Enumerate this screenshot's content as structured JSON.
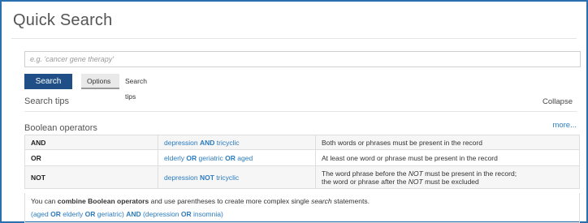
{
  "title": "Quick Search",
  "search": {
    "placeholder": "e.g. 'cancer gene therapy'",
    "value": ""
  },
  "buttons": {
    "search": "Search"
  },
  "tabs": [
    {
      "label": "Options"
    },
    {
      "label": "Search tips"
    }
  ],
  "tips": {
    "heading": "Search tips",
    "collapse": "Collapse",
    "boolean_heading": "Boolean operators",
    "more": "more...",
    "rows": [
      {
        "op": "AND",
        "ex": [
          "depression",
          "AND",
          "tricyclic"
        ],
        "desc": "Both words or phrases must be present in the record"
      },
      {
        "op": "OR",
        "ex": [
          "elderly",
          "OR",
          "geriatric",
          "OR",
          "aged"
        ],
        "desc": "At least one word or phrase must be present in the record"
      },
      {
        "op": "NOT",
        "ex": [
          "depression",
          "NOT",
          "tricyclic"
        ],
        "desc1_pre": "The word phrase before the",
        "desc1_em": "NOT",
        "desc1_post": "must be present in the record;",
        "desc2_pre": "the word or phrase after the",
        "desc2_em": "NOT",
        "desc2_post": "must be excluded"
      }
    ],
    "note": {
      "p1": "You can",
      "b1": "combine Boolean operators",
      "p2": "and use parentheses to create more complex single",
      "em": "search",
      "p3": "statements."
    },
    "example": {
      "t1": "(aged",
      "op1": "OR",
      "t2": "elderly",
      "op2": "OR",
      "t3": "geriatric)",
      "op3": "AND",
      "t4": "(depression",
      "op4": "OR",
      "t5": "insomnia)"
    }
  }
}
